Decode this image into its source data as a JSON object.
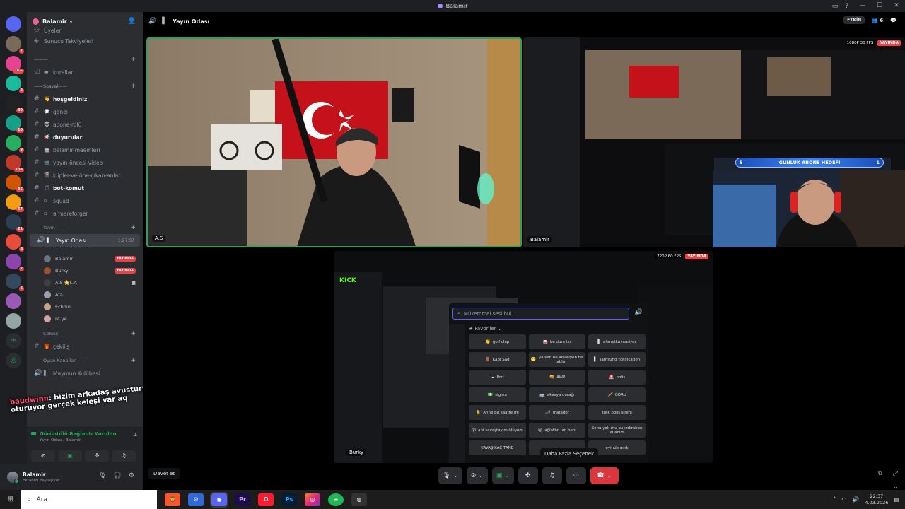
{
  "window": {
    "title": "Balamir"
  },
  "guild_badges": [
    "7",
    "1K+",
    "2",
    "30",
    "10",
    "9",
    "108",
    "35",
    "67",
    "21",
    "8",
    "2",
    "6"
  ],
  "server": {
    "name": "Balamir"
  },
  "channel_list": {
    "top_items": [
      {
        "icon": "people-icon",
        "name": "Üyeler"
      },
      {
        "icon": "boost-icon",
        "name": "Sunucu Takviyeleri"
      }
    ],
    "rules_channel": {
      "emoji": "▬",
      "name": "kurallar"
    },
    "categories": {
      "social": "Sosyal",
      "broadcast": "Yayın",
      "giveaway": "Çekiliş",
      "game": "Oyun Kanalları"
    },
    "social_channels": [
      {
        "emoji": "👋",
        "name": "hoşgeldiniz",
        "bold": true
      },
      {
        "emoji": "💬",
        "name": "genel",
        "bold": false
      },
      {
        "emoji": "👽",
        "name": "abone-rolü",
        "bold": false
      },
      {
        "emoji": "📢",
        "name": "duyurular",
        "bold": true
      },
      {
        "emoji": "🤖",
        "name": "balamir-meemleri",
        "bold": false
      },
      {
        "emoji": "📹",
        "name": "yayın-öncesi-video",
        "bold": false
      },
      {
        "emoji": "🎬",
        "name": "klipler-ve-öne-çıkan-anlar",
        "bold": false
      },
      {
        "emoji": "🎵",
        "name": "bot-komut",
        "bold": true
      },
      {
        "emoji": "▫",
        "name": "squad",
        "bold": false
      },
      {
        "emoji": "▫",
        "name": "armareforger",
        "bold": false
      }
    ],
    "voice_channel": {
      "name": "Yayın Odası",
      "time": "1:27:37",
      "status": "Bir kanal durumu belirle"
    },
    "voice_users": [
      {
        "name": "Balamir",
        "live": "YAYINDA",
        "color": "#6b7280"
      },
      {
        "name": "Burky",
        "live": "YAYINDA",
        "color": "#a0522d"
      },
      {
        "name": "A.S ⭐L.A",
        "live": "",
        "color": "#3f3f46"
      },
      {
        "name": "Ata",
        "live": "",
        "color": "#9ca3af"
      },
      {
        "name": "Echhin",
        "live": "",
        "color": "#c4a484"
      },
      {
        "name": "nt.ye",
        "live": "",
        "color": "#d1a3a4"
      }
    ],
    "giveaway_channel": {
      "name": "çekiliş"
    },
    "game_channel": {
      "name": "Maymun Kulübesi"
    }
  },
  "overlay": {
    "speaker": "baudwinn",
    "message": ": bizim arkadaş avusturya da oturuyor gerçek keleşi var aq"
  },
  "voice_panel": {
    "status": "Görüntülü Bağlantı Kuruldu",
    "location": "Yayın Odası / Balamir"
  },
  "user_panel": {
    "name": "Balamir",
    "status": "Ekranını paylaşıyor"
  },
  "stage": {
    "channel_name": "Yayın Odası",
    "event_label": "ETKİN",
    "participant_count": "6",
    "tile_main_label": "A.S",
    "tile_top_right": {
      "label": "Balamir",
      "quality": "1080P 30 FPS",
      "live": "YAYINDA"
    },
    "tile_bottom": {
      "quality": "720P 60 FPS",
      "live": "YAYINDA",
      "label": "Burky"
    },
    "goal_banner": {
      "left": "5",
      "text": "GÜNLÜK ABONE HEDEFİ",
      "right": "1"
    },
    "soundboard": {
      "search_placeholder": "Mükemmel sesi bul",
      "favorites_label": "Favoriler",
      "sounds": [
        "golf clap",
        "ba dum tss",
        "ahmetkayaariyor",
        "Kapı Sağ",
        "ya sen ne anlatıyon be abla",
        "samsung notification",
        "Prrt",
        "AWP",
        "polis",
        "sigma",
        "akasya durağı",
        "BORU",
        "Anne bu saatte mi",
        "matador",
        "türk polis sireni",
        "abi savaştayım ölüyom",
        "ağlatbn lan beni",
        "Sonu yok mu bu ızdıraben allahım",
        "YAVAŞ KAÇ TANE",
        "",
        "evinde amk"
      ]
    },
    "tooltip": "Daha Fazla Seçenek",
    "invite_button": "Davet et"
  },
  "taskbar": {
    "search_placeholder": "Ara",
    "time": "22:37",
    "date": "4.03.2026"
  }
}
